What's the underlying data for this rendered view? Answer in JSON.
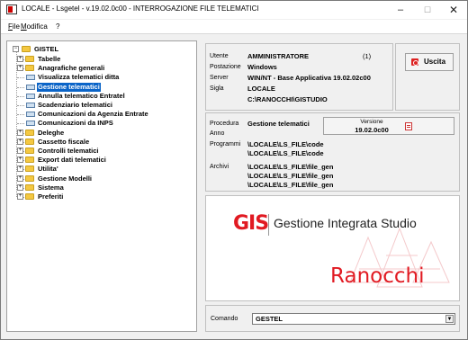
{
  "window": {
    "title": "LOCALE - Lsgetel - v.19.02.0c00 - INTERROGAZIONE FILE TELEMATICI",
    "controls": {
      "minimize": "–",
      "maximize": "☐",
      "close": "✕"
    }
  },
  "menu": [
    {
      "acc": "F",
      "rest": "ile"
    },
    {
      "acc": "M",
      "rest": "odifica"
    },
    {
      "acc": "",
      "rest": "?"
    }
  ],
  "tree": {
    "root": "GISTEL",
    "items": [
      {
        "label": "Tabelle",
        "kind": "folder",
        "expandable": true,
        "selected": false
      },
      {
        "label": "Anagrafiche generali",
        "kind": "folder",
        "expandable": true,
        "selected": false
      },
      {
        "label": "Visualizza telematici ditta",
        "kind": "doc",
        "expandable": false,
        "selected": false
      },
      {
        "label": "Gestione telematici",
        "kind": "doc",
        "expandable": false,
        "selected": true
      },
      {
        "label": "Annulla telematico Entratel",
        "kind": "doc",
        "expandable": false,
        "selected": false
      },
      {
        "label": "Scadenziario telematici",
        "kind": "doc",
        "expandable": false,
        "selected": false
      },
      {
        "label": "Comunicazioni da Agenzia Entrate",
        "kind": "doc",
        "expandable": false,
        "selected": false
      },
      {
        "label": "Comunicazioni da INPS",
        "kind": "doc",
        "expandable": false,
        "selected": false
      },
      {
        "label": "Deleghe",
        "kind": "folder",
        "expandable": true,
        "selected": false
      },
      {
        "label": "Cassetto fiscale",
        "kind": "folder",
        "expandable": true,
        "selected": false
      },
      {
        "label": "Controlli telematici",
        "kind": "folder",
        "expandable": true,
        "selected": false
      },
      {
        "label": "Export dati telematici",
        "kind": "folder",
        "expandable": true,
        "selected": false
      },
      {
        "label": "Utilita'",
        "kind": "folder",
        "expandable": true,
        "selected": false
      },
      {
        "label": "Gestione Modelli",
        "kind": "folder",
        "expandable": true,
        "selected": false
      },
      {
        "label": "Sistema",
        "kind": "folder",
        "expandable": true,
        "selected": false
      },
      {
        "label": "Preferiti",
        "kind": "folder",
        "expandable": true,
        "selected": false
      }
    ]
  },
  "info": {
    "utente_label": "Utente",
    "utente": "AMMINISTRATORE",
    "utente_num": "(1)",
    "postazione_label": "Postazione",
    "postazione": "Windows",
    "server_label": "Server",
    "server": "WIN/NT - Base Applicativa 19.02.02c00",
    "sigla_label": "Sigla",
    "sigla": "LOCALE",
    "path": "C:\\RANOCCHI\\GISTUDIO"
  },
  "uscita_label": "Uscita",
  "proc": {
    "procedura_label": "Procedura",
    "procedura": "Gestione telematici",
    "anno_label": "Anno",
    "programmi_label": "Programmi",
    "programmi": [
      "\\LOCALE\\LS_FILE\\code",
      "\\LOCALE\\LS_FILE\\code"
    ],
    "archivi_label": "Archivi",
    "archivi": [
      "\\LOCALE\\LS_FILE\\file_gen",
      "\\LOCALE\\LS_FILE\\file_gen",
      "\\LOCALE\\LS_FILE\\file_gen"
    ],
    "versione_label": "Versione",
    "versione": "19.02.0c00"
  },
  "logo": {
    "gis": "GIS",
    "name": "Gestione Integrata Studio",
    "brand": "Ranocchi",
    "brand_color": "#e11a22"
  },
  "comando": {
    "label": "Comando",
    "value": "GESTEL"
  },
  "colors": {
    "selection": "#0a64c8",
    "accent": "#e11a22"
  }
}
